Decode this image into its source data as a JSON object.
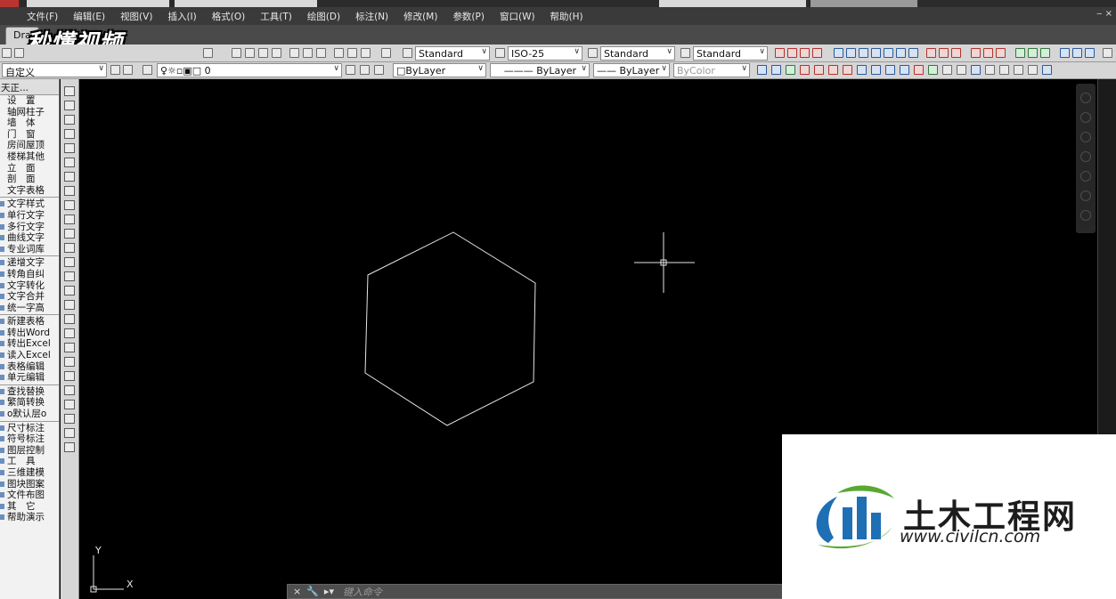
{
  "menubar": {
    "items": [
      "文件(F)",
      "编辑(E)",
      "视图(V)",
      "插入(I)",
      "格式(O)",
      "工具(T)",
      "绘图(D)",
      "标注(N)",
      "修改(M)",
      "参数(P)",
      "窗口(W)",
      "帮助(H)"
    ]
  },
  "tabs": {
    "active": "Dra"
  },
  "watermark_top": "秒懂视频",
  "toolbar1": {
    "text_style": "Standard",
    "dim_style": "ISO-25",
    "table_style": "Standard",
    "multileader_style": "Standard"
  },
  "toolbar2": {
    "workspace": "自定义",
    "layer": "0",
    "color": "ByLayer",
    "linetype": "ByLayer",
    "lineweight": "ByLayer",
    "plotstyle": "ByColor"
  },
  "palette": {
    "title": "天正...",
    "groups": [
      [
        "设　置",
        "轴网柱子",
        "墙　体",
        "门　窗",
        "房间屋顶",
        "楼梯其他",
        "立　面",
        "剖　面",
        "文字表格"
      ],
      [
        "文字样式",
        "单行文字",
        "多行文字",
        "曲线文字",
        "专业词库"
      ],
      [
        "递增文字",
        "转角自纠",
        "文字转化",
        "文字合并",
        "统一字高"
      ],
      [
        "新建表格",
        "转出Word",
        "转出Excel",
        "读入Excel",
        "表格编辑",
        "单元编辑"
      ],
      [
        "查找替换",
        "繁简转换",
        "o默认层o"
      ],
      [
        "尺寸标注",
        "符号标注",
        "图层控制",
        "工　具",
        "三维建模",
        "图块图案",
        "文件布图",
        "其　它",
        "帮助演示"
      ]
    ]
  },
  "ucs": {
    "x_label": "X",
    "y_label": "Y"
  },
  "command": {
    "placeholder": "键入命令",
    "close": "×",
    "settings": "🔧"
  },
  "logo": {
    "name": "土木工程网",
    "url": "www.civilcn.com"
  },
  "colors": {
    "canvas": "#000000",
    "hexagon": "#e6e6e6",
    "logo_blue": "#1f6fb5",
    "logo_green": "#5aa832"
  }
}
